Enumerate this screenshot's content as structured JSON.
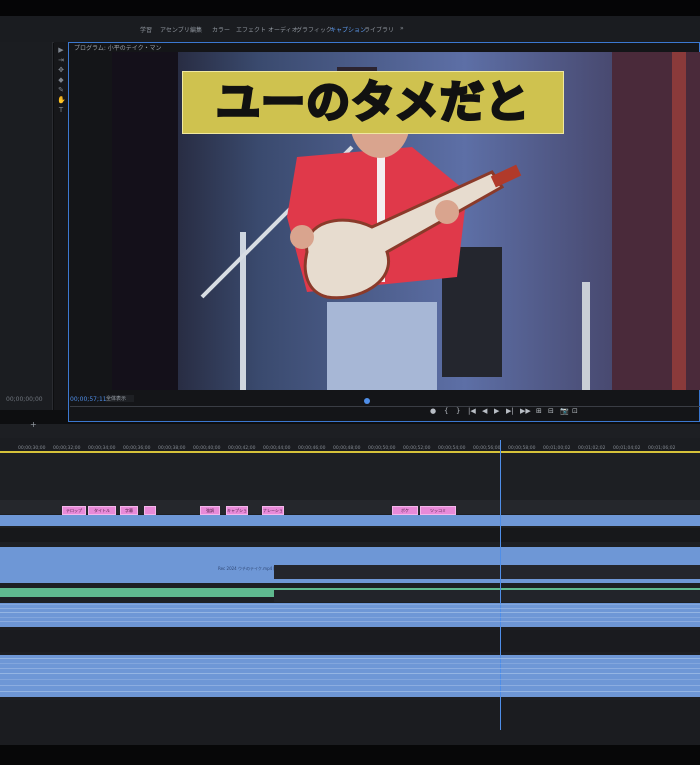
{
  "workspaces": [
    "学習",
    "アセンブリ",
    "編集",
    "カラー",
    "エフェクト",
    "オーディオ",
    "グラフィック",
    "キャプション",
    "ライブラリ",
    "»"
  ],
  "workspace_active": "キャプション",
  "program_monitor": {
    "title": "プログラム: 小平のテイク・マン",
    "caption_text": "ユーのタメだと",
    "timecode": "00;00;57;11",
    "fit": "全体表示"
  },
  "left_panel": {
    "timecode": "00;00;00;00"
  },
  "tools": [
    "▶",
    "⇥",
    "✥",
    "◆",
    "✎",
    "✋",
    "T"
  ],
  "transport": [
    "●",
    "{",
    "}",
    "|◀",
    "◀",
    "▶",
    "▶|",
    "▶▶",
    "⊞",
    "⊟",
    "📷",
    "⊡"
  ],
  "timeline": {
    "add_button": "+",
    "ruler_ticks": [
      "00;00;30;00",
      "00;00;32;00",
      "00;00;34;00",
      "00;00;36;00",
      "00;00;38;00",
      "00;00;40;00",
      "00;00;42;00",
      "00;00;44;00",
      "00;00;46;00",
      "00;00;48;00",
      "00;00;50;00",
      "00;00;52;00",
      "00;00;54;00",
      "00;00;56;00",
      "00;00;58;00",
      "00;01;00;02",
      "00;01;02;02",
      "00;01;04;02",
      "00;01;06;02"
    ],
    "markers": [
      "テロップ",
      "タイトル",
      "字幕",
      "",
      "強調",
      "キャプション",
      "ナレーション",
      "ボケ",
      "ツッコミ"
    ],
    "clip_label": "Rec 2024 ウチのテイク.mp4 [V]"
  },
  "colors": {
    "accent": "#4f8ee8",
    "caption_bg": "#cfc24f",
    "clip_video": "#6e97d6",
    "clip_audio": "#5fb98f",
    "marker": "#e88ad8"
  }
}
